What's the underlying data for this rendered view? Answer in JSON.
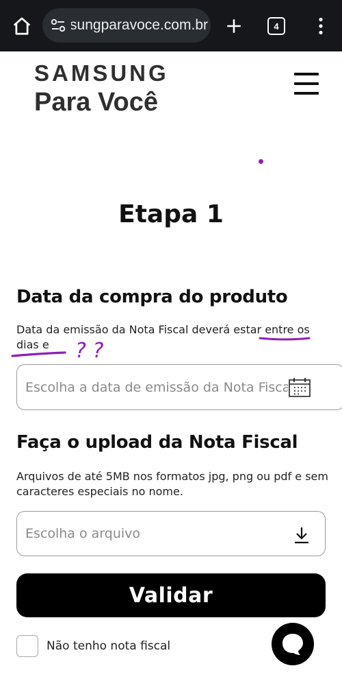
{
  "browser": {
    "url": "sungparavoce.com.br",
    "tab_count": "4"
  },
  "site": {
    "logo_line1": "SAMSUNG",
    "logo_line2": "Para Você"
  },
  "page": {
    "step_title": "Etapa 1",
    "section1": {
      "heading": "Data da compra do produto",
      "description": "Data da emissão da Nota Fiscal deverá estar entre os dias e",
      "date_placeholder": "Escolha a data de emissão da Nota Fiscal"
    },
    "section2": {
      "heading": "Faça o upload da Nota Fiscal",
      "description": "Arquivos de até 5MB nos formatos jpg, png ou pdf e sem caracteres especiais no nome.",
      "file_placeholder": "Escolha o arquivo"
    },
    "validate_button": "Validar",
    "no_invoice_label": "Não tenho nota fiscal"
  },
  "annotation": {
    "question_marks": "? ?"
  },
  "colors": {
    "annotation": "#8d1fb6",
    "browser_bar": "#15171a",
    "button": "#000000"
  },
  "icons": [
    "home-icon",
    "site-settings-icon",
    "plus-icon",
    "tabs-icon",
    "more-vert-icon",
    "menu-icon",
    "calendar-icon",
    "download-icon",
    "chat-icon"
  ]
}
